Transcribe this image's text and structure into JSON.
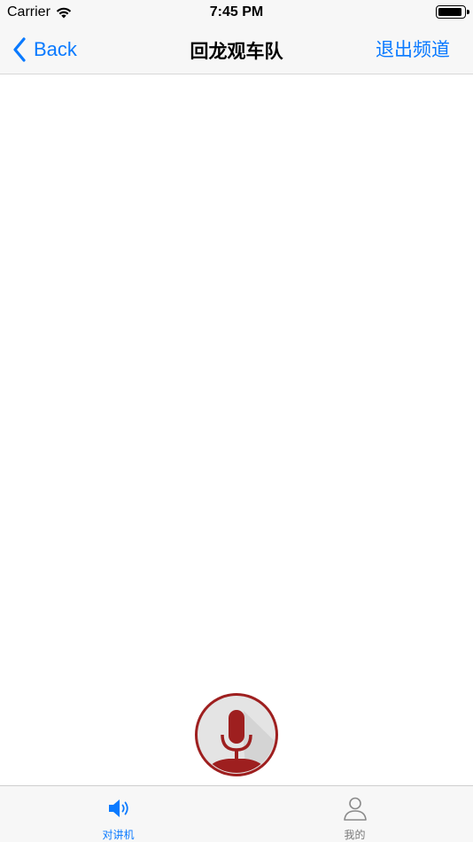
{
  "status_bar": {
    "carrier": "Carrier",
    "time": "7:45 PM"
  },
  "nav": {
    "back_label": "Back",
    "title": "回龙观车队",
    "exit_label": "退出频道"
  },
  "tabs": [
    {
      "label": "对讲机",
      "icon": "speaker-icon",
      "active": true
    },
    {
      "label": "我的",
      "icon": "person-icon",
      "active": false
    }
  ],
  "colors": {
    "accent": "#0a7aff",
    "mic_red": "#9e1f1f",
    "bar_bg": "#f7f7f7"
  }
}
